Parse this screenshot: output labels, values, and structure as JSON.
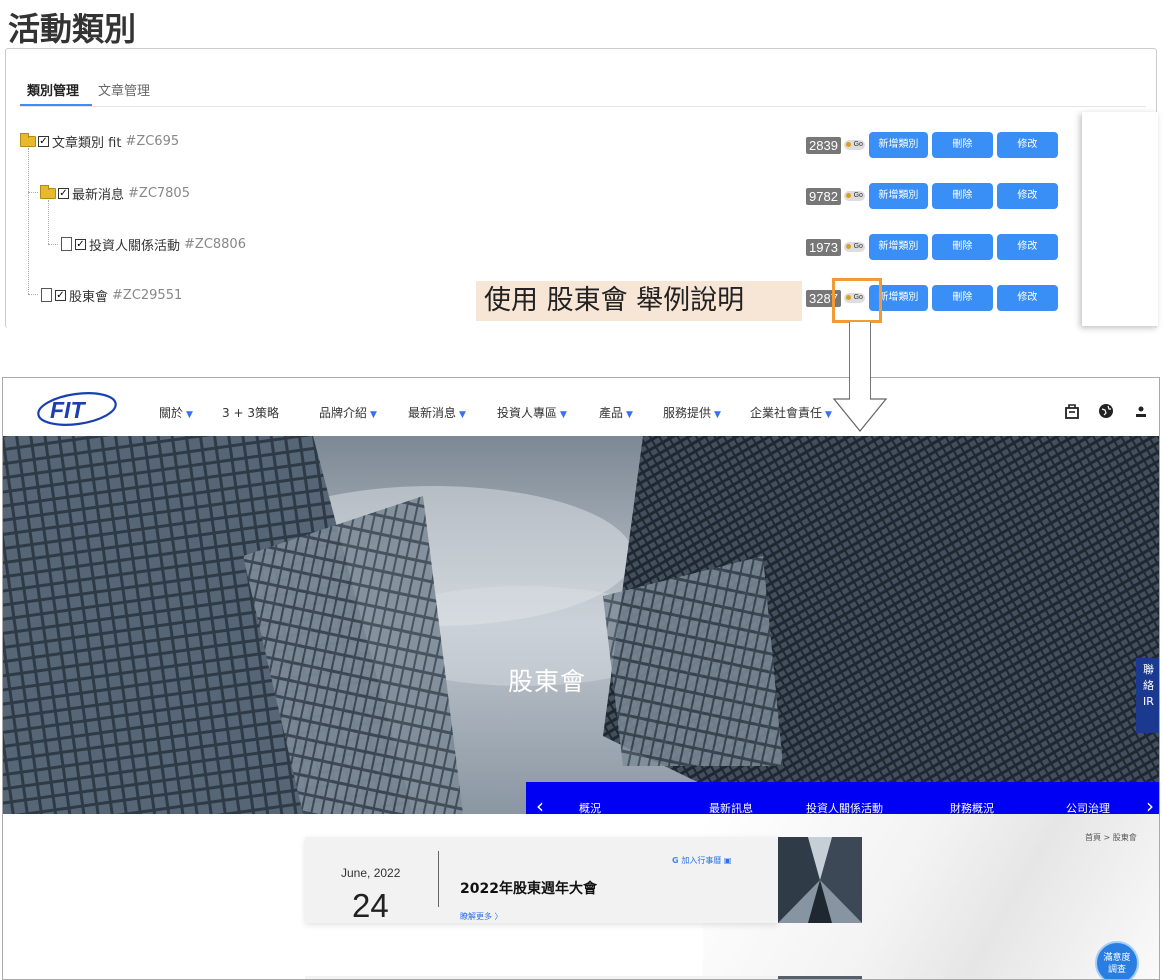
{
  "admin": {
    "page_title": "活動類別",
    "tabs": [
      {
        "label": "類別管理",
        "active": true
      },
      {
        "label": "文章管理",
        "active": false
      }
    ],
    "tree": [
      {
        "name": "文章類別 fit",
        "code": "#ZC695",
        "count": "2839",
        "icon": "folder-icon",
        "checked": true
      },
      {
        "name": "最新消息",
        "code": "#ZC7805",
        "count": "9782",
        "icon": "folder-icon",
        "checked": true
      },
      {
        "name": "投資人關係活動",
        "code": "#ZC8806",
        "count": "1973",
        "icon": "document-icon",
        "checked": true
      },
      {
        "name": "股東會",
        "code": "#ZC29551",
        "count": "3287",
        "icon": "document-icon",
        "checked": true
      }
    ],
    "go_label": "Go",
    "buttons": {
      "add": "新增類別",
      "delete": "刪除",
      "edit": "修改"
    }
  },
  "annotation": {
    "callout": "使用 股東會 舉例說明"
  },
  "site": {
    "logo_text": "FIT",
    "nav": [
      {
        "label": "關於",
        "dropdown": true
      },
      {
        "label": "3 + 3策略",
        "dropdown": false
      },
      {
        "label": "品牌介紹",
        "dropdown": true
      },
      {
        "label": "最新消息",
        "dropdown": true
      },
      {
        "label": "投資人專區",
        "dropdown": true
      },
      {
        "label": "產品",
        "dropdown": true
      },
      {
        "label": "服務提供",
        "dropdown": true
      },
      {
        "label": "企業社會責任",
        "dropdown": true
      }
    ],
    "nav_icons": [
      "briefcase-icon",
      "globe-icon",
      "user-icon"
    ],
    "hero_title": "股東會",
    "ir_tab": [
      "聯",
      "絡",
      "IR"
    ],
    "subnav": [
      "概況",
      "最新訊息",
      "投資人關係活動",
      "財務概況",
      "公司治理"
    ],
    "breadcrumb": "首頁 > 股東會",
    "event": {
      "month": "June, 2022",
      "day": "24",
      "title": "2022年股東週年大會",
      "more": "瞭解更多 〉",
      "calendar": "加入行事曆"
    },
    "survey": [
      "滿意度",
      "調查"
    ],
    "colors": {
      "accent": "#3a8ff7",
      "subnav": "#0000f5",
      "callout_border": "#f29a33"
    }
  }
}
